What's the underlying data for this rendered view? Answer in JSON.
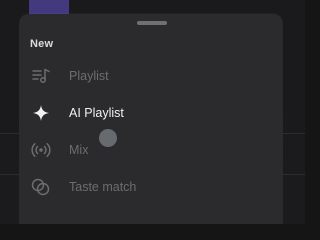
{
  "menu": {
    "section_title": "New",
    "items": [
      {
        "label": "Playlist",
        "icon": "playlist-add-icon",
        "enabled": false
      },
      {
        "label": "AI Playlist",
        "icon": "sparkle-icon",
        "enabled": true
      },
      {
        "label": "Mix",
        "icon": "broadcast-icon",
        "enabled": false
      },
      {
        "label": "Taste match",
        "icon": "taste-match-icon",
        "enabled": false
      }
    ]
  },
  "colors": {
    "sheet_background": "#2b2b2d",
    "active_text": "#f2f2f2",
    "disabled_text": "#6d6d70"
  }
}
